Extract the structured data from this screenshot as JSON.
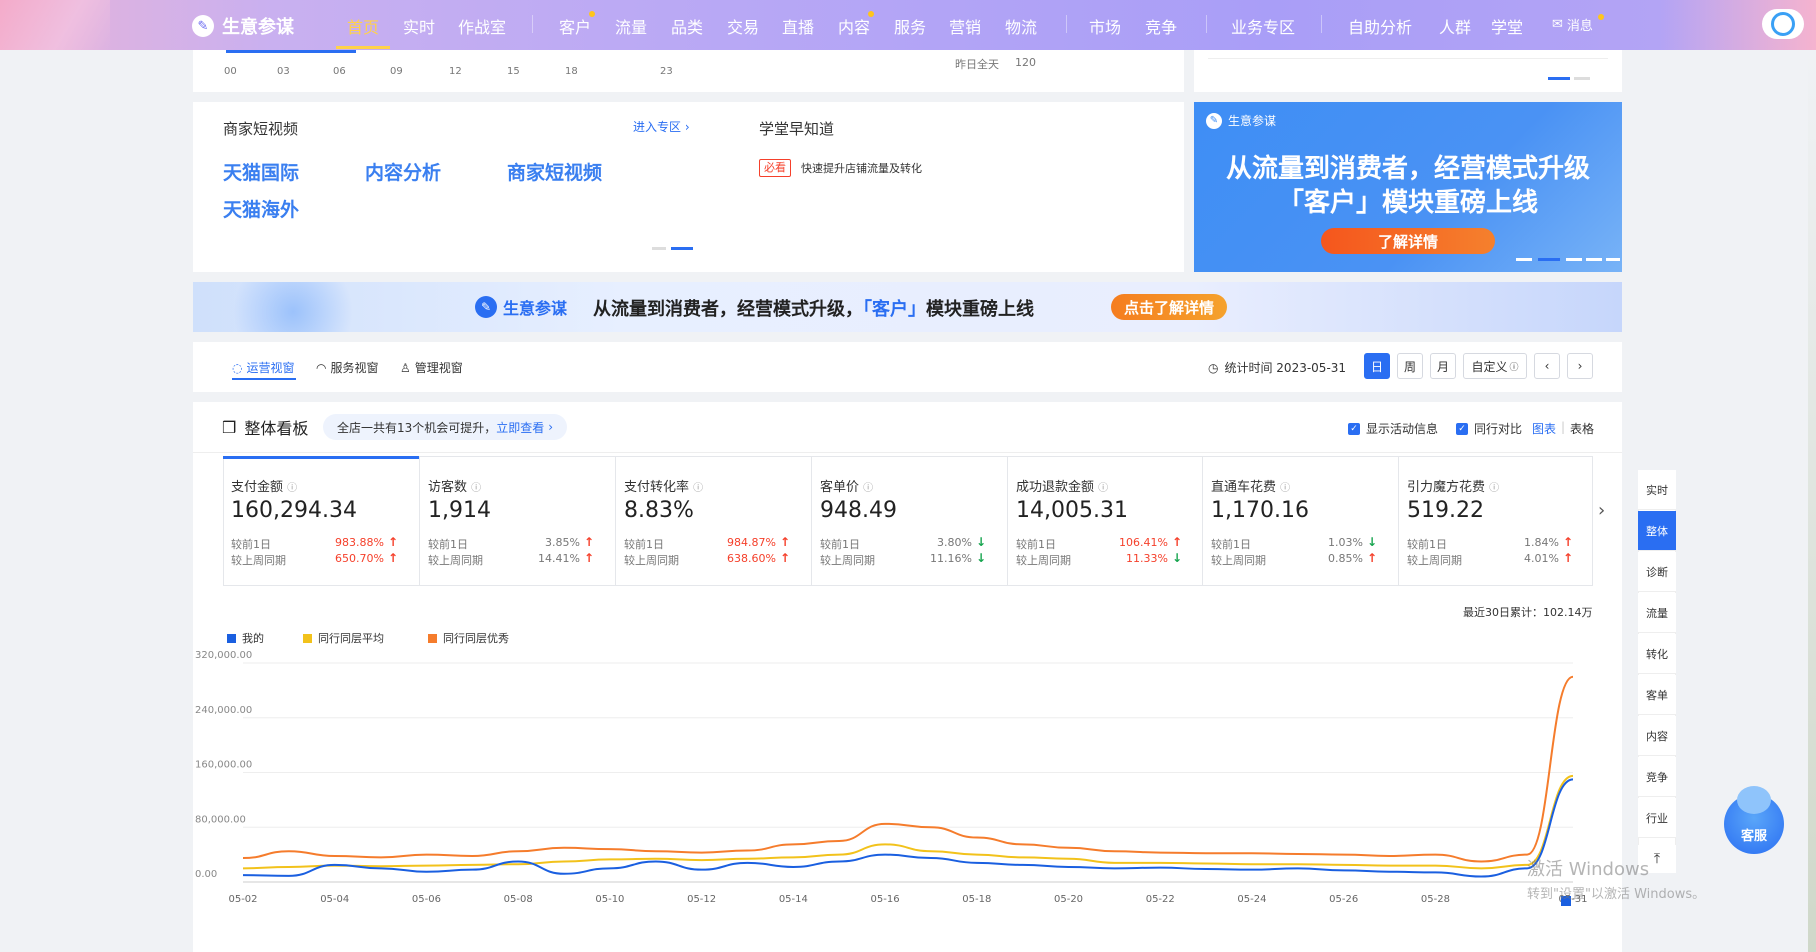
{
  "nav": {
    "logo": "生意参谋",
    "items": [
      "首页",
      "实时",
      "作战室",
      "客户",
      "流量",
      "品类",
      "交易",
      "直播",
      "内容",
      "服务",
      "营销",
      "物流",
      "市场",
      "竞争",
      "业务专区",
      "自助分析",
      "人群",
      "学堂"
    ],
    "message": "消息",
    "accent": "#ffd24a"
  },
  "top_strip": {
    "hours": [
      "00",
      "03",
      "06",
      "09",
      "12",
      "15",
      "18",
      "23"
    ],
    "yesterday_label": "昨日全天",
    "yesterday_value": "120"
  },
  "short_video": {
    "title": "商家短视频",
    "enter_link": "进入专区",
    "tiles": [
      "天猫国际",
      "内容分析",
      "商家短视频",
      "天猫海外"
    ]
  },
  "school": {
    "title": "学堂早知道",
    "badge": "必看",
    "item": "快速提升店铺流量及转化"
  },
  "promo_card": {
    "brand": "生意参谋",
    "line1": "从流量到消费者，经营模式升级",
    "line2": "「客户」模块重磅上线",
    "button": "了解详情"
  },
  "banner": {
    "brand": "生意参谋",
    "text_a": "从流量到消费者，经营模式升级，",
    "highlight": "「客户」",
    "text_b": "模块重磅上线",
    "button": "点击了解详情"
  },
  "view_tabs": {
    "tabs": [
      "运营视窗",
      "服务视窗",
      "管理视窗"
    ],
    "stat_time": "统计时间 2023-05-31",
    "periods": [
      "日",
      "周",
      "月",
      "自定义"
    ]
  },
  "board": {
    "title": "整体看板",
    "opportunity": "全店一共有13个机会可提升，",
    "opportunity_link": "立即查看",
    "show_activity": "显示活动信息",
    "peer_compare": "同行对比",
    "view_chart": "图表",
    "view_table": "表格"
  },
  "metrics": [
    {
      "label": "支付金额",
      "value": "160,294.34",
      "cmp1": "较前1日",
      "pct1": "983.88%",
      "dir1": "up",
      "cmp2": "较上周同期",
      "pct2": "650.70%",
      "dir2": "up",
      "hot": true
    },
    {
      "label": "访客数",
      "value": "1,914",
      "cmp1": "较前1日",
      "pct1": "3.85%",
      "dir1": "up",
      "cmp2": "较上周同期",
      "pct2": "14.41%",
      "dir2": "up",
      "hot": false
    },
    {
      "label": "支付转化率",
      "value": "8.83%",
      "cmp1": "较前1日",
      "pct1": "984.87%",
      "dir1": "up",
      "cmp2": "较上周同期",
      "pct2": "638.60%",
      "dir2": "up",
      "hot": true
    },
    {
      "label": "客单价",
      "value": "948.49",
      "cmp1": "较前1日",
      "pct1": "3.80%",
      "dir1": "dn",
      "cmp2": "较上周同期",
      "pct2": "11.16%",
      "dir2": "dn",
      "hot": false
    },
    {
      "label": "成功退款金额",
      "value": "14,005.31",
      "cmp1": "较前1日",
      "pct1": "106.41%",
      "dir1": "up",
      "cmp2": "较上周同期",
      "pct2": "11.33%",
      "dir2": "dn",
      "hot": true
    },
    {
      "label": "直通车花费",
      "value": "1,170.16",
      "cmp1": "较前1日",
      "pct1": "1.03%",
      "dir1": "dn",
      "cmp2": "较上周同期",
      "pct2": "0.85%",
      "dir2": "up",
      "hot": false
    },
    {
      "label": "引力魔方花费",
      "value": "519.22",
      "cmp1": "较前1日",
      "pct1": "1.84%",
      "dir1": "up",
      "cmp2": "较上周同期",
      "pct2": "4.01%",
      "dir2": "up",
      "hot": false
    }
  ],
  "side_nav": [
    "实时",
    "整体",
    "诊断",
    "流量",
    "转化",
    "客单",
    "内容",
    "竞争",
    "行业"
  ],
  "cs_label": "客服",
  "watermark": {
    "line1": "激活 Windows",
    "line2": "转到\"设置\"以激活 Windows。"
  },
  "chart_data": {
    "type": "line",
    "total_label": "最近30日累计：102.14万",
    "ylim": [
      0,
      320000
    ],
    "yticks": [
      "0.00",
      "80,000.00",
      "160,000.00",
      "240,000.00",
      "320,000.00"
    ],
    "x": [
      "05-02",
      "05-03",
      "05-04",
      "05-05",
      "05-06",
      "05-07",
      "05-08",
      "05-09",
      "05-10",
      "05-11",
      "05-12",
      "05-13",
      "05-14",
      "05-15",
      "05-16",
      "05-17",
      "05-18",
      "05-19",
      "05-20",
      "05-21",
      "05-22",
      "05-23",
      "05-24",
      "05-25",
      "05-26",
      "05-27",
      "05-28",
      "05-29",
      "05-30",
      "05-31"
    ],
    "xtick_labels": [
      "05-02",
      "05-04",
      "05-06",
      "05-08",
      "05-10",
      "05-12",
      "05-14",
      "05-16",
      "05-18",
      "05-20",
      "05-22",
      "05-24",
      "05-26",
      "05-28",
      "05-31"
    ],
    "series": [
      {
        "name": "我的",
        "color": "#1a5fe0",
        "values": [
          10000,
          9000,
          25000,
          20000,
          15000,
          18000,
          30000,
          12000,
          20000,
          30000,
          18000,
          28000,
          22000,
          30000,
          40000,
          35000,
          28000,
          25000,
          22000,
          20000,
          21000,
          19000,
          18000,
          20000,
          17000,
          15000,
          14000,
          8000,
          20000,
          150000
        ]
      },
      {
        "name": "同行同层平均",
        "color": "#f2c21b",
        "values": [
          20000,
          22000,
          24000,
          23000,
          24000,
          25000,
          26000,
          30000,
          33000,
          34000,
          32000,
          34000,
          36000,
          40000,
          55000,
          45000,
          40000,
          36000,
          34000,
          28000,
          28000,
          27000,
          26000,
          26000,
          25000,
          24000,
          24000,
          20000,
          25000,
          155000
        ]
      },
      {
        "name": "同行同层优秀",
        "color": "#f57c2c",
        "values": [
          35000,
          45000,
          38000,
          36000,
          40000,
          38000,
          45000,
          50000,
          48000,
          45000,
          43000,
          46000,
          55000,
          60000,
          85000,
          80000,
          65000,
          55000,
          50000,
          45000,
          43000,
          42000,
          42000,
          41000,
          40000,
          38000,
          40000,
          30000,
          40000,
          300000
        ]
      }
    ]
  }
}
